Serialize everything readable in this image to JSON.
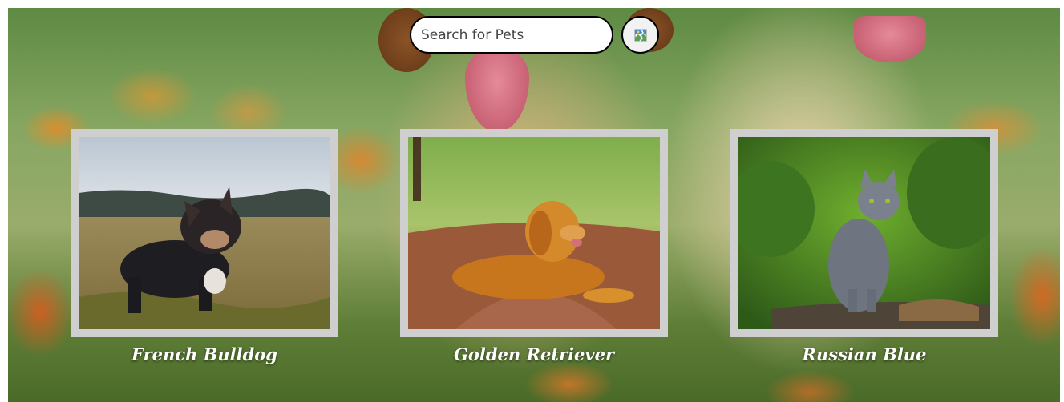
{
  "search": {
    "placeholder": "Search for Pets",
    "value": "",
    "button_icon": "broken-image-icon"
  },
  "pets": [
    {
      "name": "French Bulldog",
      "photo": "french-bulldog-photo"
    },
    {
      "name": "Golden Retriever",
      "photo": "golden-retriever-photo"
    },
    {
      "name": "Russian Blue",
      "photo": "russian-blue-photo"
    }
  ],
  "colors": {
    "card_frame": "#cfcfcf",
    "label_text": "#ffffff",
    "search_border": "#000000"
  }
}
